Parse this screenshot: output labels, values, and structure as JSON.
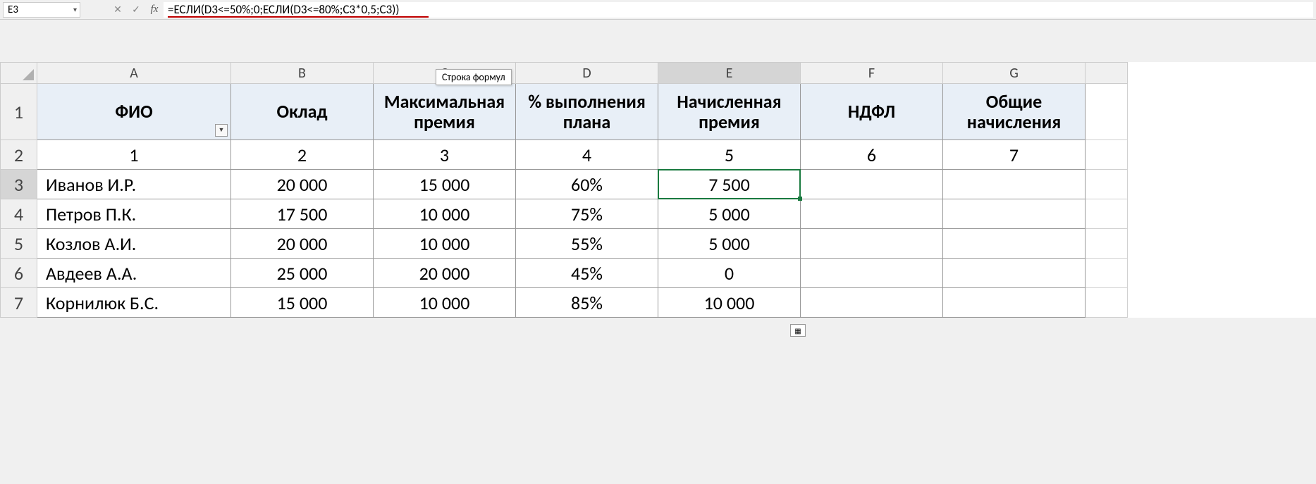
{
  "nameBox": "E3",
  "formula": "=ЕСЛИ(D3<=50%;0;ЕСЛИ(D3<=80%;C3*0,5;C3))",
  "tooltip": "Строка формул",
  "columns": [
    "A",
    "B",
    "C",
    "D",
    "E",
    "F",
    "G"
  ],
  "rowNums": [
    "1",
    "2",
    "3",
    "4",
    "5",
    "6",
    "7"
  ],
  "headers": {
    "A": "ФИО",
    "B": "Оклад",
    "C": "Максимальная премия",
    "D": "% выполнения плана",
    "E": "Начисленная премия",
    "F": "НДФЛ",
    "G": "Общие начисления"
  },
  "row2": {
    "A": "1",
    "B": "2",
    "C": "3",
    "D": "4",
    "E": "5",
    "F": "6",
    "G": "7"
  },
  "rows": [
    {
      "A": "Иванов И.Р.",
      "B": "20 000",
      "C": "15 000",
      "D": "60%",
      "E": "7 500",
      "F": "",
      "G": ""
    },
    {
      "A": "Петров П.К.",
      "B": "17 500",
      "C": "10 000",
      "D": "75%",
      "E": "5 000",
      "F": "",
      "G": ""
    },
    {
      "A": "Козлов А.И.",
      "B": "20 000",
      "C": "10 000",
      "D": "55%",
      "E": "5 000",
      "F": "",
      "G": ""
    },
    {
      "A": "Авдеев А.А.",
      "B": "25 000",
      "C": "20 000",
      "D": "45%",
      "E": "0",
      "F": "",
      "G": ""
    },
    {
      "A": "Корнилюк Б.С.",
      "B": "15 000",
      "C": "10 000",
      "D": "85%",
      "E": "10 000",
      "F": "",
      "G": ""
    }
  ],
  "fbIcons": {
    "cancel": "✕",
    "enter": "✓"
  }
}
